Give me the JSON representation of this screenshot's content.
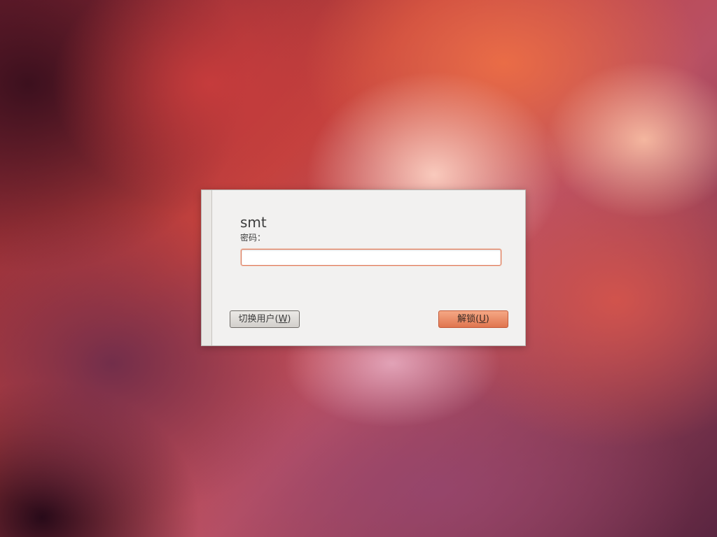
{
  "dialog": {
    "username": "smt",
    "password_label": "密码：",
    "password_value": "",
    "switch_user": {
      "prefix": "切换用户(",
      "mnemonic": "W",
      "suffix": ")"
    },
    "unlock": {
      "prefix": "解锁(",
      "mnemonic": "U",
      "suffix": ")"
    }
  },
  "colors": {
    "dialog_bg": "#f2f1f0",
    "input_focus_border": "#e0795a",
    "unlock_button": "#e98d67",
    "switch_button": "#dddad6"
  }
}
